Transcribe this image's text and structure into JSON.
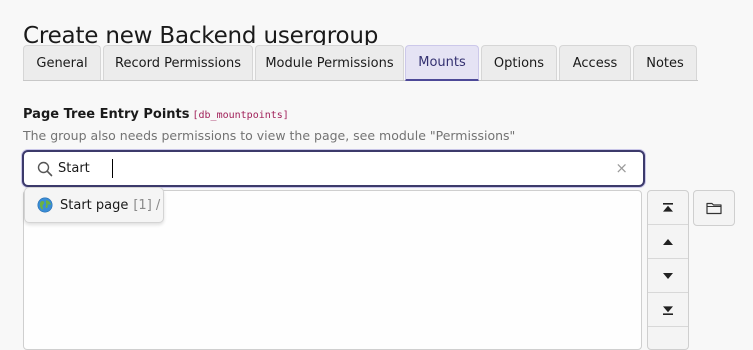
{
  "page": {
    "title": "Create new Backend usergroup"
  },
  "tabs": [
    {
      "label": "General",
      "active": false
    },
    {
      "label": "Record Permissions",
      "active": false
    },
    {
      "label": "Module Permissions",
      "active": false
    },
    {
      "label": "Mounts",
      "active": true
    },
    {
      "label": "Options",
      "active": false
    },
    {
      "label": "Access",
      "active": false
    },
    {
      "label": "Notes",
      "active": false
    }
  ],
  "field": {
    "label": "Page Tree Entry Points",
    "code": "[db_mountpoints]",
    "help": "The group also needs permissions to view the page, see module \"Permissions\""
  },
  "search": {
    "value": "Start",
    "clear_symbol": "×"
  },
  "suggestion": {
    "title": "Start page",
    "uid": "[1] /",
    "icon": "globe-icon"
  },
  "side_buttons": {
    "move_top": "move-top-icon",
    "move_up": "move-up-icon",
    "move_down": "move-down-icon",
    "move_bottom": "move-bottom-icon",
    "browse": "folder-icon"
  },
  "colors": {
    "accent": "#4d4998",
    "active_tab_bg": "#e5e3f4",
    "focus_border": "#3c3a6b",
    "code": "#a1215a"
  }
}
